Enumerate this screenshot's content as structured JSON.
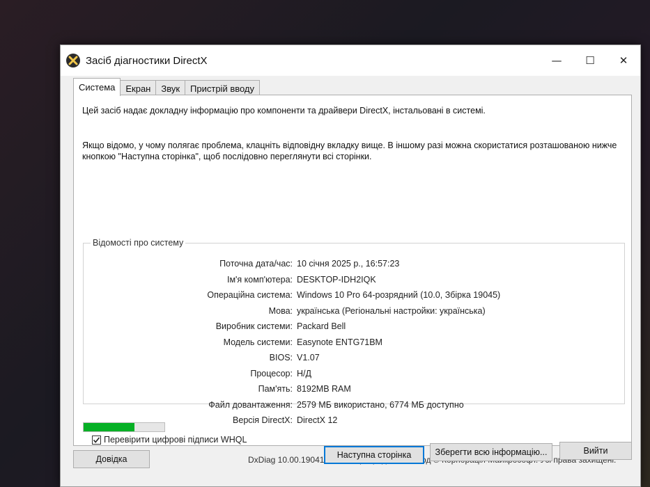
{
  "window": {
    "title": "Засіб діагностики DirectX",
    "controls": {
      "minimize": "—",
      "maximize": "☐",
      "close": "✕"
    }
  },
  "tabs": [
    {
      "label": "Система",
      "active": true
    },
    {
      "label": "Екран",
      "active": false
    },
    {
      "label": "Звук",
      "active": false
    },
    {
      "label": "Пристрій вводу",
      "active": false
    }
  ],
  "intro": {
    "line1": "Цей засіб надає докладну інформацію про компоненти та драйвери DirectX, інстальовані в системі.",
    "line2": "Якщо відомо, у чому полягає проблема, клацніть відповідну вкладку вище. В іншому разі можна скористатися розташованою нижче кнопкою \"Наступна сторінка\", щоб послідовно переглянути всі сторінки."
  },
  "system_info": {
    "legend": "Відомості про систему",
    "rows": [
      {
        "label": "Поточна дата/час:",
        "value": "10 січня 2025 р., 16:57:23"
      },
      {
        "label": "Ім'я комп'ютера:",
        "value": "DESKTOP-IDH2IQK"
      },
      {
        "label": "Операційна система:",
        "value": "Windows 10 Pro 64-розрядний (10.0, Збірка 19045)"
      },
      {
        "label": "Мова:",
        "value": "українська (Регіональні настройки: українська)"
      },
      {
        "label": "Виробник системи:",
        "value": "Packard Bell"
      },
      {
        "label": "Модель системи:",
        "value": "Easynote ENTG71BM"
      },
      {
        "label": "BIOS:",
        "value": "V1.07"
      },
      {
        "label": "Процесор:",
        "value": "Н/Д"
      },
      {
        "label": "Пам'ять:",
        "value": "8192MB RAM"
      },
      {
        "label": "Файл довантаження:",
        "value": "2579 МБ використано, 6774 МБ доступно"
      },
      {
        "label": "Версія DirectX:",
        "value": "DirectX 12"
      }
    ]
  },
  "whql": {
    "label": "Перевірити цифрові підписи WHQL",
    "checked": true
  },
  "footer": {
    "text": "DxDiag 10.00.19041.4717 64-розрядний Юнікод  © Корпорація Майкрософт.  Усі права захищені."
  },
  "progress": {
    "fraction": 0.63,
    "color": "#06b025"
  },
  "buttons": {
    "help": "Довідка",
    "next": "Наступна сторінка",
    "save": "Зберегти всю інформацію...",
    "exit": "Вийти"
  },
  "colors": {
    "accent": "#0078d7",
    "window_bg": "#f0f0f0"
  }
}
